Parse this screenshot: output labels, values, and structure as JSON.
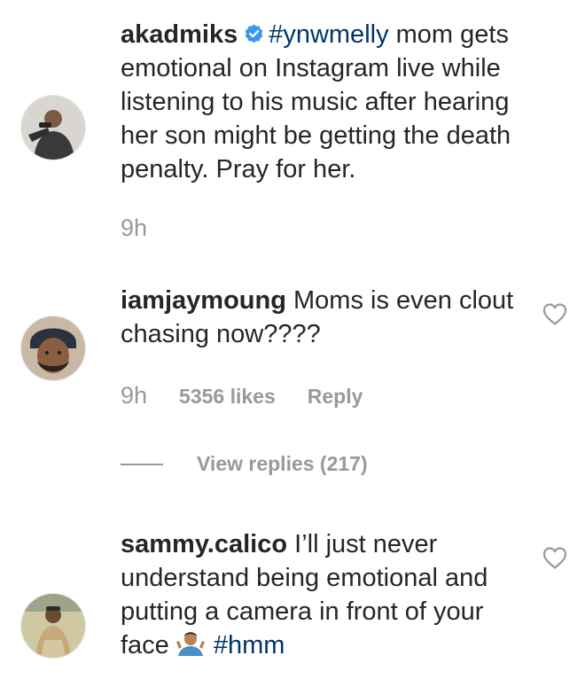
{
  "comments": [
    {
      "username": "akadmiks",
      "verified": true,
      "hashtag": "#ynwmelly",
      "text": "mom gets emotional on Instagram live while listening to his music after hearing her son might be getting the death penalty. Pray for her.",
      "time": "9h",
      "avatar_icon": "profile-photo"
    },
    {
      "username": "iamjaymoung",
      "text": "Moms is even clout chasing now????",
      "time": "9h",
      "likes": "5356 likes",
      "reply": "Reply",
      "view_replies": "View replies (217)",
      "avatar_icon": "profile-photo"
    },
    {
      "username": "sammy.calico",
      "text": "I’ll just never understand being emotional and putting a camera in front of your face",
      "emoji": "man-shrugging-emoji",
      "hashtag": "#hmm",
      "avatar_icon": "profile-photo"
    }
  ],
  "icons": {
    "like": "heart-outline-icon",
    "verified": "verified-badge-icon"
  },
  "colors": {
    "text": "#262626",
    "secondary": "#999999",
    "hashtag": "#003569",
    "verified": "#3897f0"
  }
}
